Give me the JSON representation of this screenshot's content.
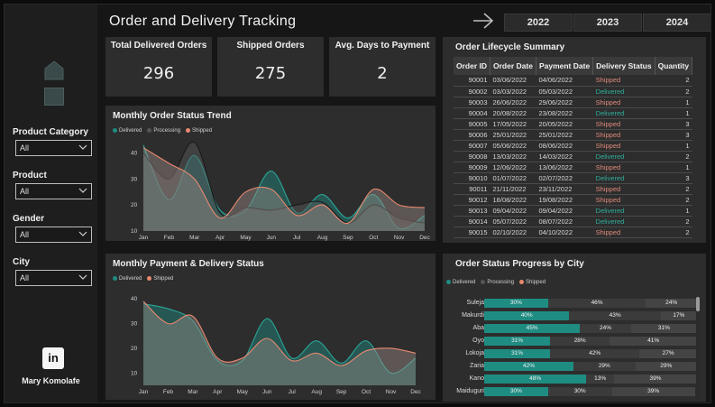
{
  "title": "Order and Delivery Tracking",
  "years": [
    "2022",
    "2023",
    "2024"
  ],
  "sidebar": {
    "filters": [
      {
        "label": "Product Category",
        "value": "All"
      },
      {
        "label": "Product",
        "value": "All"
      },
      {
        "label": "Gender",
        "value": "All"
      },
      {
        "label": "City",
        "value": "All"
      }
    ],
    "linkedin_label": "in",
    "author": "Mary Komolafe"
  },
  "kpis": [
    {
      "title": "Total Delivered Orders",
      "value": "296"
    },
    {
      "title": "Shipped Orders",
      "value": "275"
    },
    {
      "title": "Avg. Days to Payment",
      "value": "2"
    }
  ],
  "colors": {
    "delivered": "#1f8c82",
    "processing": "#3b3b3b",
    "shipped": "#e8896f",
    "panel": "#2d2d2d"
  },
  "chart_data": [
    {
      "type": "area",
      "title": "Monthly Order Status Trend",
      "legend": [
        "Delivered",
        "Processing",
        "Shipped"
      ],
      "legend_position": "top-left",
      "categories": [
        "Jan",
        "Feb",
        "Mar",
        "Apr",
        "May",
        "Jun",
        "Jul",
        "Aug",
        "Sep",
        "Oct",
        "Nov",
        "Dec"
      ],
      "yticks": [
        10,
        20,
        30,
        40
      ],
      "ylim": [
        10,
        45
      ],
      "series": [
        {
          "name": "Delivered",
          "values": [
            43,
            22,
            39,
            18,
            18,
            33,
            17,
            24,
            15,
            24,
            11,
            16
          ]
        },
        {
          "name": "Processing",
          "values": [
            40,
            30,
            44,
            17,
            19,
            18,
            20,
            21,
            13,
            20,
            15,
            13
          ]
        },
        {
          "name": "Shipped",
          "values": [
            42,
            36,
            30,
            15,
            25,
            26,
            16,
            20,
            13,
            26,
            20,
            19
          ]
        }
      ]
    },
    {
      "type": "area",
      "title": "Monthly Payment & Delivery Status",
      "legend": [
        "Delivered",
        "Shipped"
      ],
      "legend_position": "top-left",
      "categories": [
        "Jan",
        "Feb",
        "Mar",
        "Apr",
        "May",
        "Jun",
        "Jul",
        "Aug",
        "Sep",
        "Oct",
        "Nov",
        "Dec"
      ],
      "yticks": [
        10,
        20,
        30,
        40
      ],
      "ylim": [
        5,
        43
      ],
      "series": [
        {
          "name": "Delivered",
          "values": [
            38,
            36,
            31,
            15,
            15,
            32,
            16,
            23,
            14,
            23,
            10,
            16
          ]
        },
        {
          "name": "Shipped",
          "values": [
            39,
            30,
            33,
            16,
            16,
            24,
            15,
            18,
            13,
            19,
            20,
            18
          ]
        }
      ]
    },
    {
      "type": "bar",
      "orientation": "horizontal-stacked-100",
      "title": "Order Status Progress by City",
      "legend": [
        "Delivered",
        "Processing",
        "Shipped"
      ],
      "legend_position": "top-left",
      "categories": [
        "Suleja",
        "Makurdi",
        "Aba",
        "Oyo",
        "Lokoja",
        "Zaria",
        "Kano",
        "Maiduguri"
      ],
      "series": [
        {
          "name": "Delivered",
          "values": [
            30,
            40,
            45,
            31,
            31,
            42,
            48,
            30
          ]
        },
        {
          "name": "Processing",
          "values": [
            46,
            43,
            24,
            28,
            42,
            29,
            13,
            30
          ]
        },
        {
          "name": "Shipped",
          "values": [
            24,
            17,
            31,
            41,
            27,
            29,
            39,
            39
          ]
        }
      ]
    }
  ],
  "lifecycle": {
    "title": "Order Lifecycle Summary",
    "columns": [
      "Order ID",
      "Order Date",
      "Payment Date",
      "Delivery Status",
      "Quantity"
    ],
    "rows": [
      [
        "90001",
        "03/06/2022",
        "04/06/2022",
        "Shipped",
        "2"
      ],
      [
        "90002",
        "03/03/2022",
        "05/03/2022",
        "Delivered",
        "2"
      ],
      [
        "90003",
        "26/06/2022",
        "29/06/2022",
        "Shipped",
        "1"
      ],
      [
        "90004",
        "20/08/2022",
        "23/08/2022",
        "Delivered",
        "1"
      ],
      [
        "90005",
        "17/05/2022",
        "20/05/2022",
        "Shipped",
        "3"
      ],
      [
        "90006",
        "25/01/2022",
        "25/01/2022",
        "Shipped",
        "3"
      ],
      [
        "90007",
        "05/06/2022",
        "08/06/2022",
        "Shipped",
        "1"
      ],
      [
        "90008",
        "13/03/2022",
        "14/03/2022",
        "Delivered",
        "2"
      ],
      [
        "90009",
        "12/06/2022",
        "13/06/2022",
        "Shipped",
        "1"
      ],
      [
        "90010",
        "01/07/2022",
        "02/07/2022",
        "Delivered",
        "3"
      ],
      [
        "90011",
        "21/11/2022",
        "23/11/2022",
        "Shipped",
        "2"
      ],
      [
        "90012",
        "18/08/2022",
        "19/08/2022",
        "Shipped",
        "2"
      ],
      [
        "90013",
        "09/04/2022",
        "09/04/2022",
        "Delivered",
        "1"
      ],
      [
        "90014",
        "05/07/2022",
        "08/07/2022",
        "Delivered",
        "2"
      ],
      [
        "90015",
        "02/10/2022",
        "04/10/2022",
        "Shipped",
        "2"
      ]
    ]
  }
}
